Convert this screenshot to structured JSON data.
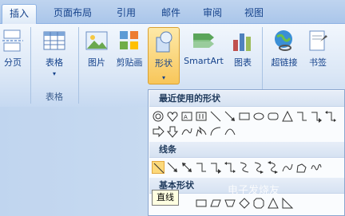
{
  "tabs": [
    {
      "label": "插入",
      "active": true
    },
    {
      "label": "页面布局",
      "active": false
    },
    {
      "label": "引用",
      "active": false
    },
    {
      "label": "邮件",
      "active": false
    },
    {
      "label": "审阅",
      "active": false
    },
    {
      "label": "视图",
      "active": false
    }
  ],
  "ribbon": {
    "buttons": [
      {
        "label": "分页",
        "icon": "page-break-icon"
      },
      {
        "label": "表格",
        "icon": "table-icon"
      },
      {
        "label": "图片",
        "icon": "picture-icon"
      },
      {
        "label": "剪贴画",
        "icon": "clipart-icon"
      },
      {
        "label": "形状",
        "icon": "shapes-icon"
      },
      {
        "label": "SmartArt",
        "icon": "smartart-icon"
      },
      {
        "label": "图表",
        "icon": "chart-icon"
      },
      {
        "label": "超链接",
        "icon": "hyperlink-icon"
      },
      {
        "label": "书签",
        "icon": "bookmark-icon"
      }
    ],
    "group_label_tables": "表格"
  },
  "gallery": {
    "recent_title": "最近使用的形状",
    "lines_title": "线条",
    "basic_title": "基本形状",
    "tooltip": "直线"
  },
  "watermark": "电子发烧友",
  "colors": {
    "selected": "#f8c65a",
    "ribbon": "#dbe7f6",
    "accent": "#15428b"
  }
}
